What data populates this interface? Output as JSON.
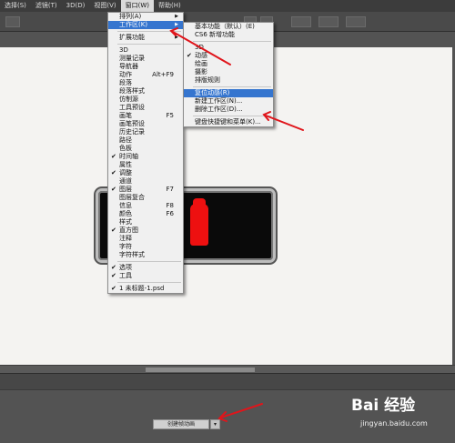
{
  "menubar": {
    "items": [
      "选择(S)",
      "滤镜(T)",
      "3D(D)",
      "视图(V)",
      "窗口(W)",
      "帮助(H)"
    ]
  },
  "window_menu": {
    "items": [
      {
        "label": "排列(A)",
        "submenu": true
      },
      {
        "label": "工作区(K)",
        "submenu": true,
        "highlighted": true
      },
      {
        "separator": true
      },
      {
        "label": "扩展功能",
        "submenu": true
      },
      {
        "separator": true
      },
      {
        "label": "3D"
      },
      {
        "label": "测量记录"
      },
      {
        "label": "导航器"
      },
      {
        "label": "动作",
        "shortcut": "Alt+F9"
      },
      {
        "label": "段落"
      },
      {
        "label": "段落样式"
      },
      {
        "label": "仿制源"
      },
      {
        "label": "工具预设"
      },
      {
        "label": "画笔",
        "shortcut": "F5"
      },
      {
        "label": "画笔预设"
      },
      {
        "label": "历史记录"
      },
      {
        "label": "路径"
      },
      {
        "label": "色板"
      },
      {
        "label": "时间轴",
        "checked": true
      },
      {
        "label": "属性"
      },
      {
        "label": "调整",
        "checked": true
      },
      {
        "label": "通道"
      },
      {
        "label": "图层",
        "shortcut": "F7",
        "checked": true
      },
      {
        "label": "图层复合"
      },
      {
        "label": "信息",
        "shortcut": "F8"
      },
      {
        "label": "颜色",
        "shortcut": "F6"
      },
      {
        "label": "样式"
      },
      {
        "label": "直方图",
        "checked": true
      },
      {
        "label": "注释"
      },
      {
        "label": "字符"
      },
      {
        "label": "字符样式"
      },
      {
        "separator": true
      },
      {
        "label": "选项",
        "checked": true
      },
      {
        "label": "工具",
        "checked": true
      },
      {
        "separator": true
      },
      {
        "label": "1 未标题-1.psd",
        "checked": true
      }
    ]
  },
  "workspace_menu": {
    "items": [
      {
        "label": "基本功能（默认）(E)"
      },
      {
        "label": "CS6 新增功能"
      },
      {
        "separator": true
      },
      {
        "label": "3D"
      },
      {
        "label": "动感",
        "checked": true
      },
      {
        "label": "绘画"
      },
      {
        "label": "摄影"
      },
      {
        "label": "排版规则"
      },
      {
        "separator": true
      },
      {
        "label": "复位动感(R)",
        "highlighted": true
      },
      {
        "label": "新建工作区(N)..."
      },
      {
        "label": "删除工作区(D)..."
      },
      {
        "separator": true
      },
      {
        "label": "键盘快捷键和菜单(K)..."
      }
    ]
  },
  "timeline": {
    "create_button_label": "创建帧动画",
    "dropdown_glyph": "▾"
  },
  "watermark": {
    "brand": "Bai 经验",
    "url": "jingyan.baidu.com"
  },
  "colors": {
    "highlight": "#3575cf",
    "annotation_arrow": "#e0151b",
    "digit": "#ee1010"
  }
}
